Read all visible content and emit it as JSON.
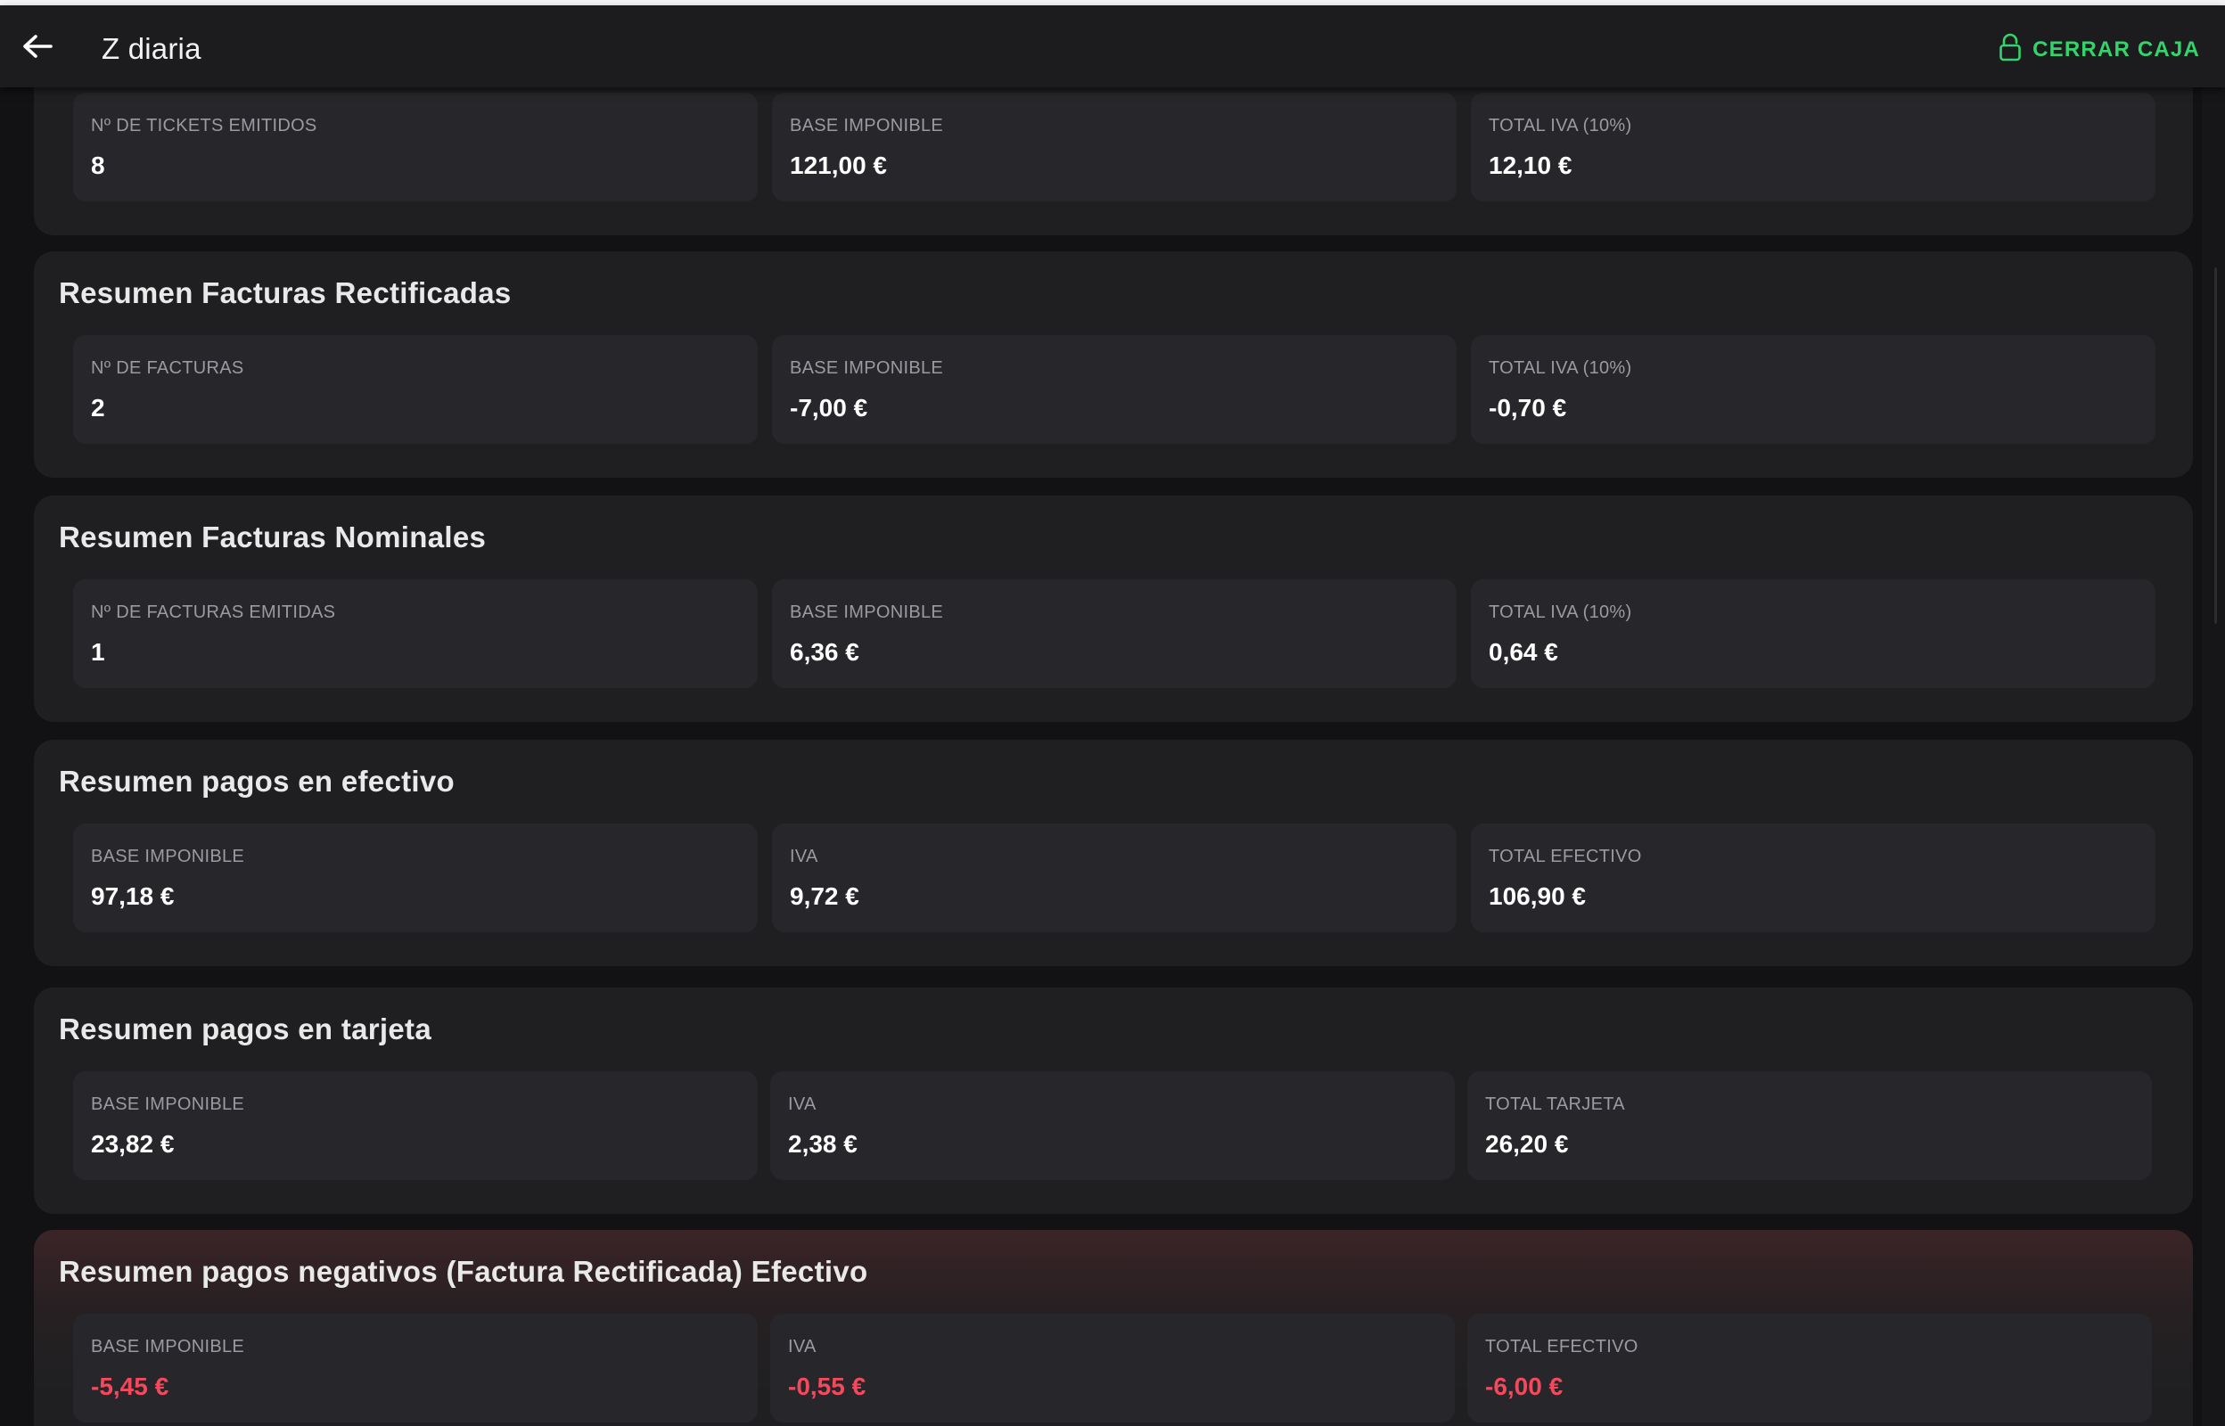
{
  "header": {
    "title": "Z diaria",
    "close_label": "CERRAR CAJA",
    "back_icon": "arrow-left-icon",
    "lock_icon": "lock-icon",
    "accent_color": "#35d36c"
  },
  "sections": [
    {
      "title": "",
      "stats": [
        {
          "label": "Nº DE TICKETS EMITIDOS",
          "value": "8"
        },
        {
          "label": "BASE IMPONIBLE",
          "value": "121,00 €"
        },
        {
          "label": "TOTAL IVA (10%)",
          "value": "12,10 €"
        }
      ]
    },
    {
      "title": "Resumen Facturas Rectificadas",
      "stats": [
        {
          "label": "Nº DE FACTURAS",
          "value": "2"
        },
        {
          "label": "BASE IMPONIBLE",
          "value": "-7,00 €"
        },
        {
          "label": "TOTAL IVA (10%)",
          "value": "-0,70 €"
        }
      ]
    },
    {
      "title": "Resumen Facturas Nominales",
      "stats": [
        {
          "label": "Nº DE FACTURAS EMITIDAS",
          "value": "1"
        },
        {
          "label": "BASE IMPONIBLE",
          "value": "6,36 €"
        },
        {
          "label": "TOTAL IVA (10%)",
          "value": "0,64 €"
        }
      ]
    },
    {
      "title": "Resumen pagos en efectivo",
      "stats": [
        {
          "label": "BASE IMPONIBLE",
          "value": "97,18 €"
        },
        {
          "label": "IVA",
          "value": "9,72 €"
        },
        {
          "label": "TOTAL EFECTIVO",
          "value": "106,90 €"
        }
      ]
    },
    {
      "title": "Resumen pagos en tarjeta",
      "stats": [
        {
          "label": "BASE IMPONIBLE",
          "value": "23,82 €"
        },
        {
          "label": "IVA",
          "value": "2,38 €"
        },
        {
          "label": "TOTAL TARJETA",
          "value": "26,20 €"
        }
      ]
    },
    {
      "title": "Resumen pagos negativos (Factura Rectificada) Efectivo",
      "negative_color": "#f4485c",
      "stats": [
        {
          "label": "BASE IMPONIBLE",
          "value": "-5,45 €"
        },
        {
          "label": "IVA",
          "value": "-0,55 €"
        },
        {
          "label": "TOTAL EFECTIVO",
          "value": "-6,00 €"
        }
      ]
    }
  ]
}
